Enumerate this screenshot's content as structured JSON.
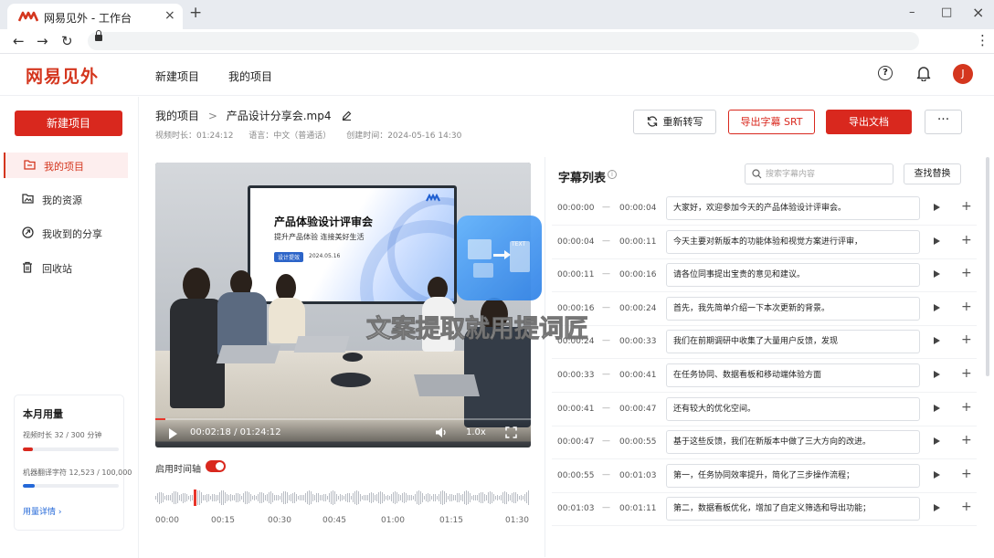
{
  "browser": {
    "tab_title": "网易见外 - 工作台",
    "new_tab": "+",
    "tab_close": "×",
    "window_minimize": "–",
    "window_maximize": "□",
    "window_close": "×",
    "menu": "⋮"
  },
  "header": {
    "brand": "网易见外",
    "nav": [
      "新建项目",
      "我的项目"
    ],
    "avatar": "J",
    "help": "?",
    "accent": "#d9281e"
  },
  "sidebar": {
    "new_project": "新建项目",
    "items": [
      {
        "label": "我的项目",
        "icon": "folder-icon",
        "active": true
      },
      {
        "label": "我的资源",
        "icon": "image-folder-icon",
        "active": false
      },
      {
        "label": "我收到的分享",
        "icon": "share-icon",
        "active": false
      },
      {
        "label": "回收站",
        "icon": "trash-icon",
        "active": false
      }
    ],
    "usage": {
      "title": "本月用量",
      "video_label": "视频时长 32 / 300 分钟",
      "video_fraction": 0.107,
      "translate_label": "机器翻译字符 12,523 / 100,000",
      "translate_fraction": 0.125,
      "details": "用量详情 ›"
    }
  },
  "project": {
    "breadcrumb_root": "我的项目",
    "breadcrumb_sep": ">",
    "file_name": "产品设计分享会.mp4",
    "duration": "视频时长：01:24:12",
    "language": "语言：中文（普通话）",
    "created": "创建时间：2024-05-16 14:30",
    "buttons": {
      "retranscribe": "重新转写",
      "export_srt": "导出字幕 SRT",
      "export_doc": "导出文档",
      "more": "···"
    }
  },
  "video": {
    "slide_title": "产品体验设计评审会",
    "slide_subtitle": "提升产品体验  连接美好生活",
    "slide_tag": "设计提效",
    "slide_date": "2024.05.16",
    "time": "00:02:18 / 01:24:12",
    "speed": "1.0x",
    "progress_fraction": 0.027
  },
  "timeline": {
    "label": "启用时间轴",
    "enabled": true,
    "ticks": [
      "00:00",
      "00:15",
      "00:30",
      "00:45",
      "01:00",
      "01:15",
      "01:30"
    ]
  },
  "subtitles": {
    "title": "字幕列表",
    "search_placeholder": "搜索字幕内容",
    "find_replace": "查找替换",
    "dash": "—",
    "add": "+",
    "rows": [
      {
        "start": "00:00:00",
        "end": "00:00:04",
        "text": "大家好，欢迎参加今天的产品体验设计评审会。"
      },
      {
        "start": "00:00:04",
        "end": "00:00:11",
        "text": "今天主要对新版本的功能体验和视觉方案进行评审，"
      },
      {
        "start": "00:00:11",
        "end": "00:00:16",
        "text": "请各位同事提出宝贵的意见和建议。"
      },
      {
        "start": "00:00:16",
        "end": "00:00:24",
        "text": "首先，我先简单介绍一下本次更新的背景。"
      },
      {
        "start": "00:00:24",
        "end": "00:00:33",
        "text": "我们在前期调研中收集了大量用户反馈，发现"
      },
      {
        "start": "00:00:33",
        "end": "00:00:41",
        "text": "在任务协同、数据看板和移动端体验方面"
      },
      {
        "start": "00:00:41",
        "end": "00:00:47",
        "text": "还有较大的优化空间。"
      },
      {
        "start": "00:00:47",
        "end": "00:00:55",
        "text": "基于这些反馈，我们在新版本中做了三大方向的改进。"
      },
      {
        "start": "00:00:55",
        "end": "00:01:03",
        "text": "第一，任务协同效率提升，简化了三步操作流程；"
      },
      {
        "start": "00:01:03",
        "end": "00:01:11",
        "text": "第二，数据看板优化，增加了自定义筛选和导出功能；"
      }
    ]
  },
  "watermark": {
    "text": "文案提取就用提词匠",
    "icon_tag": "TEXT"
  }
}
